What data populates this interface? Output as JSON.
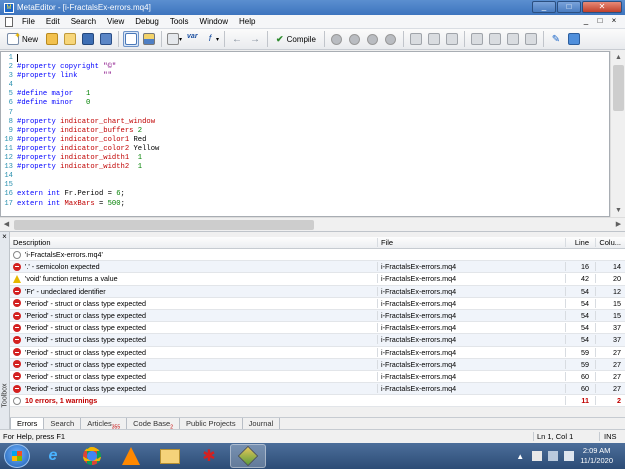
{
  "window": {
    "title": "MetaEditor - [i-FractalsEx-errors.mq4]",
    "controls": {
      "minimize": "_",
      "maximize": "□",
      "close": "✕"
    }
  },
  "menu": {
    "items": [
      "File",
      "Edit",
      "Search",
      "View",
      "Debug",
      "Tools",
      "Window",
      "Help"
    ],
    "mdi": {
      "minimize": "_",
      "restore": "□",
      "close": "×"
    }
  },
  "toolbar": {
    "new_label": "New",
    "compile_label": "Compile"
  },
  "editor": {
    "lines": [
      {
        "n": "1",
        "parts": []
      },
      {
        "n": "2",
        "parts": [
          {
            "t": "#property copyright ",
            "c": "blue"
          },
          {
            "t": "\"©\"",
            "c": "purple"
          }
        ]
      },
      {
        "n": "3",
        "parts": [
          {
            "t": "#property link      ",
            "c": "blue"
          },
          {
            "t": "\"\"",
            "c": "purple"
          }
        ]
      },
      {
        "n": "4",
        "parts": []
      },
      {
        "n": "5",
        "parts": [
          {
            "t": "#define major   ",
            "c": "blue"
          },
          {
            "t": "1",
            "c": "green"
          }
        ]
      },
      {
        "n": "6",
        "parts": [
          {
            "t": "#define minor   ",
            "c": "blue"
          },
          {
            "t": "0",
            "c": "green"
          }
        ]
      },
      {
        "n": "7",
        "parts": []
      },
      {
        "n": "8",
        "parts": [
          {
            "t": "#property ",
            "c": "blue"
          },
          {
            "t": "indicator_chart_window",
            "c": "red"
          }
        ]
      },
      {
        "n": "9",
        "parts": [
          {
            "t": "#property ",
            "c": "blue"
          },
          {
            "t": "indicator_buffers ",
            "c": "red"
          },
          {
            "t": "2",
            "c": "green"
          }
        ]
      },
      {
        "n": "10",
        "parts": [
          {
            "t": "#property ",
            "c": "blue"
          },
          {
            "t": "indicator_color1 ",
            "c": "red"
          },
          {
            "t": "Red",
            "c": "black"
          }
        ]
      },
      {
        "n": "11",
        "parts": [
          {
            "t": "#property ",
            "c": "blue"
          },
          {
            "t": "indicator_color2 ",
            "c": "red"
          },
          {
            "t": "Yellow",
            "c": "black"
          }
        ]
      },
      {
        "n": "12",
        "parts": [
          {
            "t": "#property ",
            "c": "blue"
          },
          {
            "t": "indicator_width1  ",
            "c": "red"
          },
          {
            "t": "1",
            "c": "green"
          }
        ]
      },
      {
        "n": "13",
        "parts": [
          {
            "t": "#property ",
            "c": "blue"
          },
          {
            "t": "indicator_width2  ",
            "c": "red"
          },
          {
            "t": "1",
            "c": "green"
          }
        ]
      },
      {
        "n": "14",
        "parts": []
      },
      {
        "n": "15",
        "parts": []
      },
      {
        "n": "16",
        "parts": [
          {
            "t": "extern int ",
            "c": "blue"
          },
          {
            "t": "Fr.Period = ",
            "c": "black"
          },
          {
            "t": "6",
            "c": "green"
          },
          {
            "t": ";",
            "c": "black"
          }
        ]
      },
      {
        "n": "17",
        "parts": [
          {
            "t": "extern int ",
            "c": "blue"
          },
          {
            "t": "MaxBars",
            "c": "red"
          },
          {
            "t": " = ",
            "c": "black"
          },
          {
            "t": "500",
            "c": "green"
          },
          {
            "t": ";",
            "c": "black"
          }
        ]
      }
    ]
  },
  "errors": {
    "headers": {
      "description": "Description",
      "file": "File",
      "line": "Line",
      "column": "Colu..."
    },
    "rows": [
      {
        "type": "info",
        "description": "'i-FractalsEx-errors.mq4'",
        "file": "",
        "line": "",
        "column": ""
      },
      {
        "type": "error",
        "description": "'.' - semicolon expected",
        "file": "i-FractalsEx-errors.mq4",
        "line": "16",
        "column": "14"
      },
      {
        "type": "warning",
        "description": "'void' function returns a value",
        "file": "i-FractalsEx-errors.mq4",
        "line": "42",
        "column": "20"
      },
      {
        "type": "error",
        "description": "'Fr' - undeclared identifier",
        "file": "i-FractalsEx-errors.mq4",
        "line": "54",
        "column": "12"
      },
      {
        "type": "error",
        "description": "'Period' - struct or class type expected",
        "file": "i-FractalsEx-errors.mq4",
        "line": "54",
        "column": "15"
      },
      {
        "type": "error",
        "description": "'Period' - struct or class type expected",
        "file": "i-FractalsEx-errors.mq4",
        "line": "54",
        "column": "15"
      },
      {
        "type": "error",
        "description": "'Period' - struct or class type expected",
        "file": "i-FractalsEx-errors.mq4",
        "line": "54",
        "column": "37"
      },
      {
        "type": "error",
        "description": "'Period' - struct or class type expected",
        "file": "i-FractalsEx-errors.mq4",
        "line": "54",
        "column": "37"
      },
      {
        "type": "error",
        "description": "'Period' - struct or class type expected",
        "file": "i-FractalsEx-errors.mq4",
        "line": "59",
        "column": "27"
      },
      {
        "type": "error",
        "description": "'Period' - struct or class type expected",
        "file": "i-FractalsEx-errors.mq4",
        "line": "59",
        "column": "27"
      },
      {
        "type": "error",
        "description": "'Period' - struct or class type expected",
        "file": "i-FractalsEx-errors.mq4",
        "line": "60",
        "column": "27"
      },
      {
        "type": "error",
        "description": "'Period' - struct or class type expected",
        "file": "i-FractalsEx-errors.mq4",
        "line": "60",
        "column": "27"
      }
    ],
    "summary": {
      "text": "10 errors, 1 warnings",
      "line": "11",
      "column": "2"
    }
  },
  "toolbox": {
    "label": "Toolbox",
    "close": "×",
    "tabs": [
      {
        "label": "Errors",
        "badge": ""
      },
      {
        "label": "Search",
        "badge": ""
      },
      {
        "label": "Articles",
        "badge": "355"
      },
      {
        "label": "Code Base",
        "badge": "2"
      },
      {
        "label": "Public Projects",
        "badge": ""
      },
      {
        "label": "Journal",
        "badge": ""
      }
    ]
  },
  "statusbar": {
    "help": "For Help, press F1",
    "position": "Ln 1, Col 1",
    "mode": "INS"
  },
  "taskbar": {
    "time": "2:09 AM",
    "date": "11/1/2020"
  },
  "colors": {
    "keyword": "#0000ff",
    "property": "#c00000",
    "number": "#008000",
    "string": "#800080",
    "error": "#d32020",
    "warning": "#e6b800"
  }
}
